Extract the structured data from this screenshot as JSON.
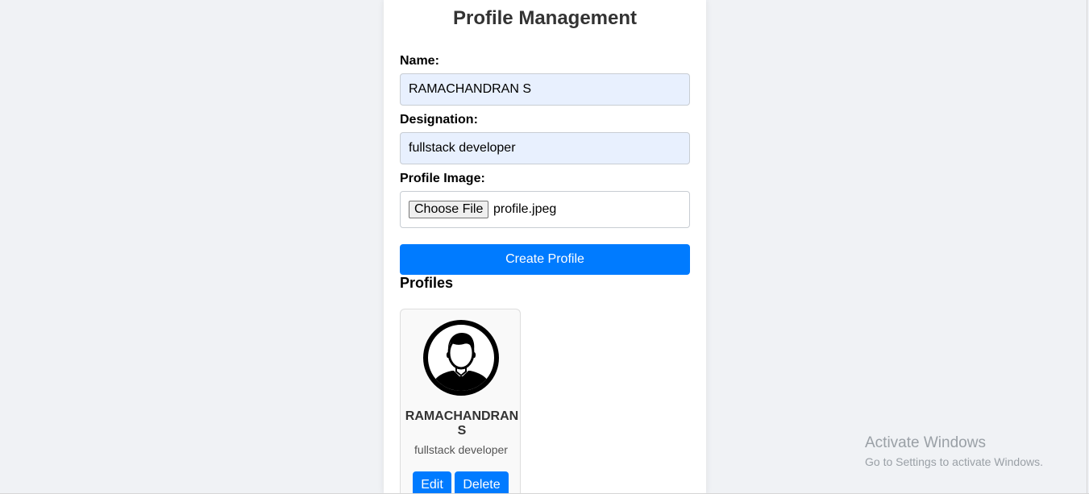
{
  "form": {
    "title": "Profile Management",
    "name_label": "Name:",
    "name_value": "RAMACHANDRAN S",
    "designation_label": "Designation:",
    "designation_value": "fullstack developer",
    "image_label": "Profile Image:",
    "choose_file_label": "Choose File",
    "file_name": "profile.jpeg",
    "create_button": "Create Profile"
  },
  "profiles": {
    "section_title": "Profiles",
    "items": [
      {
        "name_line1": "RAMACHANDRAN",
        "name_line2": "S",
        "designation": "fullstack developer",
        "avatar_icon": "user-avatar-icon",
        "edit_label": "Edit",
        "delete_label": "Delete"
      }
    ]
  },
  "watermark": {
    "title": "Activate Windows",
    "subtitle": "Go to Settings to activate Windows."
  },
  "colors": {
    "background": "#f0f2f5",
    "card": "#ffffff",
    "accent": "#007bff",
    "autofill": "#e8f0fe"
  }
}
